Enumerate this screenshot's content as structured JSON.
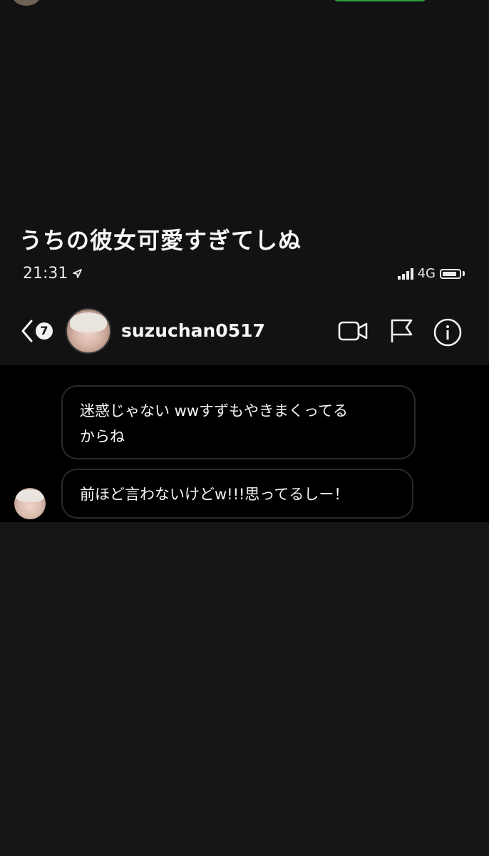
{
  "overlay": {
    "caption": "うちの彼女可愛すぎてしぬ"
  },
  "status_bar": {
    "time": "21:31",
    "network": "4G"
  },
  "dm_header": {
    "unread_count": "7",
    "username": "suzuchan0517"
  },
  "messages": [
    {
      "line1": "迷惑じゃない wwすずもやきまくってる",
      "line2": "からね"
    },
    {
      "line1": "前ほど言わないけどw!!!思ってるしー！"
    }
  ],
  "icons": {
    "back": "chevron-left-icon",
    "video": "video-camera-icon",
    "report": "flag-icon",
    "info": "info-icon",
    "location": "location-arrow-icon"
  }
}
